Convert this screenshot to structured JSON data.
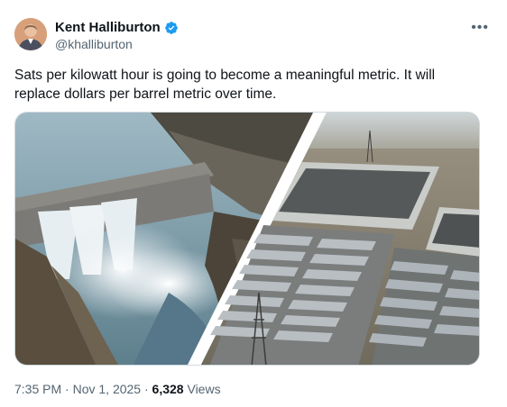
{
  "author": {
    "name": "Kent Halliburton",
    "handle": "@khalliburton",
    "verified": true
  },
  "more_icon": "more-horizontal-icon",
  "tweet": {
    "text": "Sats per kilowatt hour is going to become a meaningful metric. It will replace dollars per barrel metric over time."
  },
  "meta": {
    "time": "7:35 PM",
    "separator": "·",
    "date": "Nov 1, 2025",
    "views_count": "6,328",
    "views_label": "Views"
  },
  "colors": {
    "verified_blue": "#1d9bf0",
    "secondary_text": "#536471"
  }
}
